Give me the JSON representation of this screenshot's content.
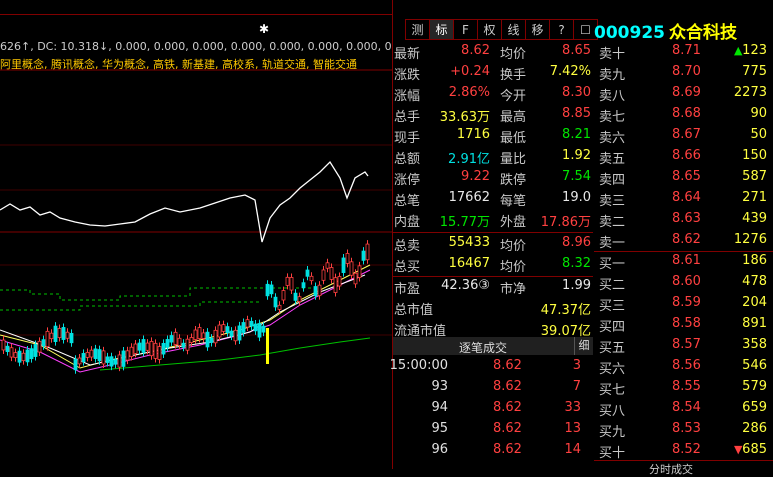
{
  "chart": {
    "indicator_prefix": "626↑, DC: 10.318↓, 0.000, 0.000, 0.000, 0.000, 0.000, 0.000, 0.000, 0.000, 0",
    "concepts": "阿里概念, 腾讯概念, 华为概念, 高铁, 新基建, 高校系, 轨道交通, 智能交通"
  },
  "tabs": [
    "测",
    "标",
    "F",
    "权",
    "线",
    "移",
    "?",
    "☐"
  ],
  "stock": {
    "code": "000925",
    "name": "众合科技"
  },
  "quote": [
    {
      "l1": "最新",
      "v1": "8.62",
      "c1": "red",
      "l2": "均价",
      "v2": "8.65",
      "c2": "red"
    },
    {
      "l1": "涨跌",
      "v1": "+0.24",
      "c1": "red",
      "l2": "换手",
      "v2": "7.42%",
      "c2": "yellow"
    },
    {
      "l1": "涨幅",
      "v1": "2.86%",
      "c1": "red",
      "l2": "今开",
      "v2": "8.30",
      "c2": "red"
    },
    {
      "l1": "总手",
      "v1": "33.63万",
      "c1": "yellow",
      "l2": "最高",
      "v2": "8.85",
      "c2": "red"
    },
    {
      "l1": "现手",
      "v1": "1716",
      "c1": "yellow",
      "l2": "最低",
      "v2": "8.21",
      "c2": "green"
    },
    {
      "l1": "总额",
      "v1": "2.91亿",
      "c1": "cyan",
      "l2": "量比",
      "v2": "1.92",
      "c2": "yellow"
    },
    {
      "l1": "涨停",
      "v1": "9.22",
      "c1": "red",
      "l2": "跌停",
      "v2": "7.54",
      "c2": "green"
    },
    {
      "l1": "总笔",
      "v1": "17662",
      "c1": "white",
      "l2": "每笔",
      "v2": "19.0",
      "c2": "white"
    },
    {
      "l1": "内盘",
      "v1": "15.77万",
      "c1": "green",
      "l2": "外盘",
      "v2": "17.86万",
      "c2": "red"
    },
    {
      "l1": "总卖",
      "v1": "55433",
      "c1": "yellow",
      "l2": "均价",
      "v2": "8.96",
      "c2": "red"
    },
    {
      "l1": "总买",
      "v1": "16467",
      "c1": "yellow",
      "l2": "均价",
      "v2": "8.32",
      "c2": "green"
    },
    {
      "l1": "市盈",
      "v1": "42.36③",
      "c1": "white",
      "l2": "市净",
      "v2": "1.99",
      "c2": "white"
    }
  ],
  "market_value": [
    {
      "label": "总市值",
      "value": "47.37亿"
    },
    {
      "label": "流通市值",
      "value": "39.07亿"
    }
  ],
  "ticks": {
    "title": "逐笔成交",
    "button": "细",
    "rows": [
      {
        "time": "15:00:00",
        "price": "8.62",
        "vol": "3"
      },
      {
        "time": "93",
        "price": "8.62",
        "vol": "7"
      },
      {
        "time": "94",
        "price": "8.62",
        "vol": "33"
      },
      {
        "time": "95",
        "price": "8.62",
        "vol": "13"
      },
      {
        "time": "96",
        "price": "8.62",
        "vol": "14"
      }
    ]
  },
  "order_book": {
    "sell": [
      {
        "label": "卖十",
        "price": "8.71",
        "vol": "123",
        "arrow": "up"
      },
      {
        "label": "卖九",
        "price": "8.70",
        "vol": "775"
      },
      {
        "label": "卖八",
        "price": "8.69",
        "vol": "2273"
      },
      {
        "label": "卖七",
        "price": "8.68",
        "vol": "90"
      },
      {
        "label": "卖六",
        "price": "8.67",
        "vol": "50"
      },
      {
        "label": "卖五",
        "price": "8.66",
        "vol": "150"
      },
      {
        "label": "卖四",
        "price": "8.65",
        "vol": "587"
      },
      {
        "label": "卖三",
        "price": "8.64",
        "vol": "271"
      },
      {
        "label": "卖二",
        "price": "8.63",
        "vol": "439"
      },
      {
        "label": "卖一",
        "price": "8.62",
        "vol": "1276"
      }
    ],
    "buy": [
      {
        "label": "买一",
        "price": "8.61",
        "vol": "186"
      },
      {
        "label": "买二",
        "price": "8.60",
        "vol": "478"
      },
      {
        "label": "买三",
        "price": "8.59",
        "vol": "204"
      },
      {
        "label": "买四",
        "price": "8.58",
        "vol": "891"
      },
      {
        "label": "买五",
        "price": "8.57",
        "vol": "358"
      },
      {
        "label": "买六",
        "price": "8.56",
        "vol": "546"
      },
      {
        "label": "买七",
        "price": "8.55",
        "vol": "579"
      },
      {
        "label": "买八",
        "price": "8.54",
        "vol": "659"
      },
      {
        "label": "买九",
        "price": "8.53",
        "vol": "286"
      },
      {
        "label": "买十",
        "price": "8.52",
        "vol": "685",
        "arrow": "down"
      }
    ]
  },
  "bottom_tab": "分时成交",
  "colors": {
    "up": "#ff4040",
    "down": "#00e600",
    "grid": "#800000"
  }
}
